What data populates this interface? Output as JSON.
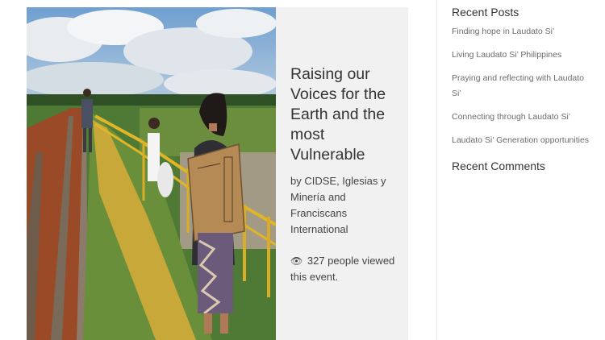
{
  "event": {
    "title": "Raising our\nVoices for the\nEarth and the\nmost Vulnerable",
    "by": "by CIDSE, Iglesias y Minería and Franciscans International",
    "views_icon": "eye-icon",
    "views_text": "327 people viewed this event."
  },
  "sidebar": {
    "recent_posts_title": "Recent Posts",
    "posts": [
      {
        "label": "Finding hope in Laudato Si’"
      },
      {
        "label": "Living Laudato Si’ Philippines"
      },
      {
        "label": "Praying and reflecting with Laudato Si’"
      },
      {
        "label": "Connecting through Laudato Si’"
      },
      {
        "label": "Laudato Si’ Generation opportunities"
      }
    ],
    "recent_comments_title": "Recent Comments"
  },
  "colors": {
    "card_bg": "#f1f1f1",
    "title_text": "#333333",
    "link_text": "#6b6b6b"
  }
}
